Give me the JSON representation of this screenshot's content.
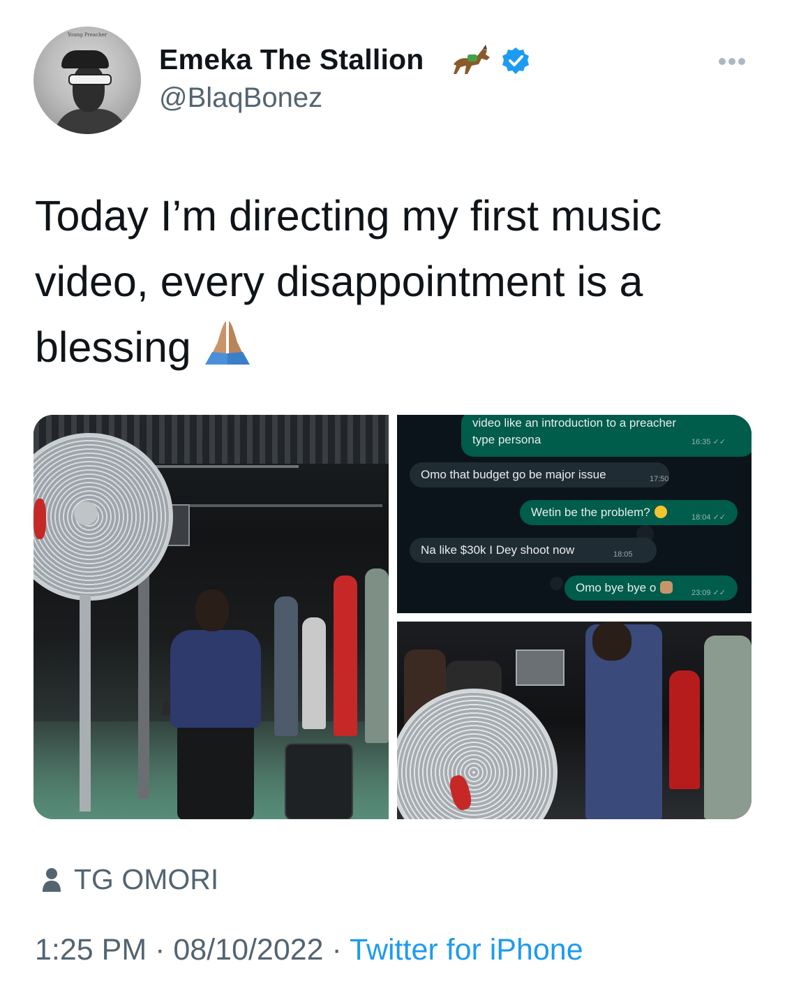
{
  "author": {
    "display_name": "Emeka The Stallion",
    "name_emoji": "horse-racing-emoji",
    "verified": true,
    "handle": "@BlaqBonez",
    "avatar_caption": "Young Preacher"
  },
  "tweet": {
    "text_lines": [
      "Today I’m directing my first music",
      "video, every disappointment is a",
      "blessing"
    ],
    "emoji": "folded-hands-emoji"
  },
  "chat": {
    "messages": [
      {
        "dir": "out",
        "text": "video like an introduction to a preacher",
        "text2": "type persona",
        "time": "16:35"
      },
      {
        "dir": "in",
        "text": "Omo that budget go be major issue",
        "time": "17:50"
      },
      {
        "dir": "out",
        "text": "Wetin be the problem?",
        "time": "18:04"
      },
      {
        "dir": "in",
        "text": "Na like $30k I Dey shoot now",
        "time": "18:05"
      },
      {
        "dir": "out",
        "text": "Omo bye bye o",
        "time": "23:09"
      }
    ]
  },
  "footer": {
    "location": "TG OMORI",
    "time": "1:25 PM",
    "sep": "·",
    "date": "08/10/2022",
    "source": "Twitter for iPhone"
  },
  "colors": {
    "link": "#1d9bf0",
    "muted": "#536471",
    "verified": "#1d9bf0",
    "chat_out": "#005c4b",
    "chat_in": "#202c33"
  }
}
